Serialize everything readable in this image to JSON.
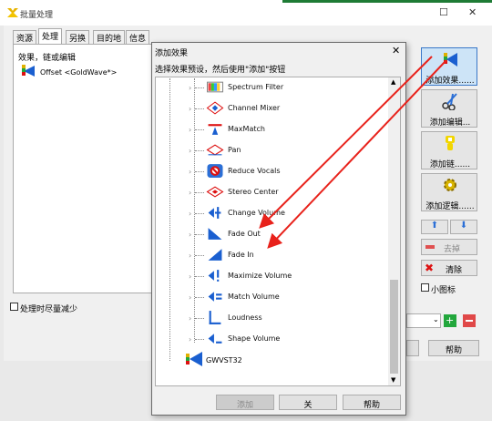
{
  "app": {
    "title": "批量处理",
    "min": "—",
    "max": "☐",
    "close": "✕"
  },
  "tabs": [
    "资源",
    "处理",
    "另换",
    "目的地",
    "信息"
  ],
  "left_panel": {
    "header": "效果，链或编辑",
    "item": "Offset <GoldWave*>",
    "minimize_label": "处理时尽量减少"
  },
  "right_buttons": {
    "add_effect": "添加效果......",
    "add_edit": "添加编辑...",
    "add_link": "添加链......",
    "add_logic": "添加逻辑......",
    "remove": "去掉",
    "clear": "清除",
    "small_icons": "小图标",
    "help": "帮助"
  },
  "dialog": {
    "title": "添加效果",
    "close": "✕",
    "instruction": "选择效果预设，然后使用\"添加\"按钮",
    "items": [
      "Spectrum Filter",
      "Channel Mixer",
      "MaxMatch",
      "Pan",
      "Reduce Vocals",
      "Stereo Center",
      "Change Volume",
      "Fade Out",
      "Fade In",
      "Maximize Volume",
      "Match Volume",
      "Loudness",
      "Shape Volume"
    ],
    "root_item": "GWVST32",
    "add_button": "添加",
    "close_button": "关",
    "help_button": "帮助"
  },
  "colors": {
    "arrow": "#e8221b",
    "accent_blue": "#1a5fd0",
    "selected_btn": "#cde4f7"
  }
}
